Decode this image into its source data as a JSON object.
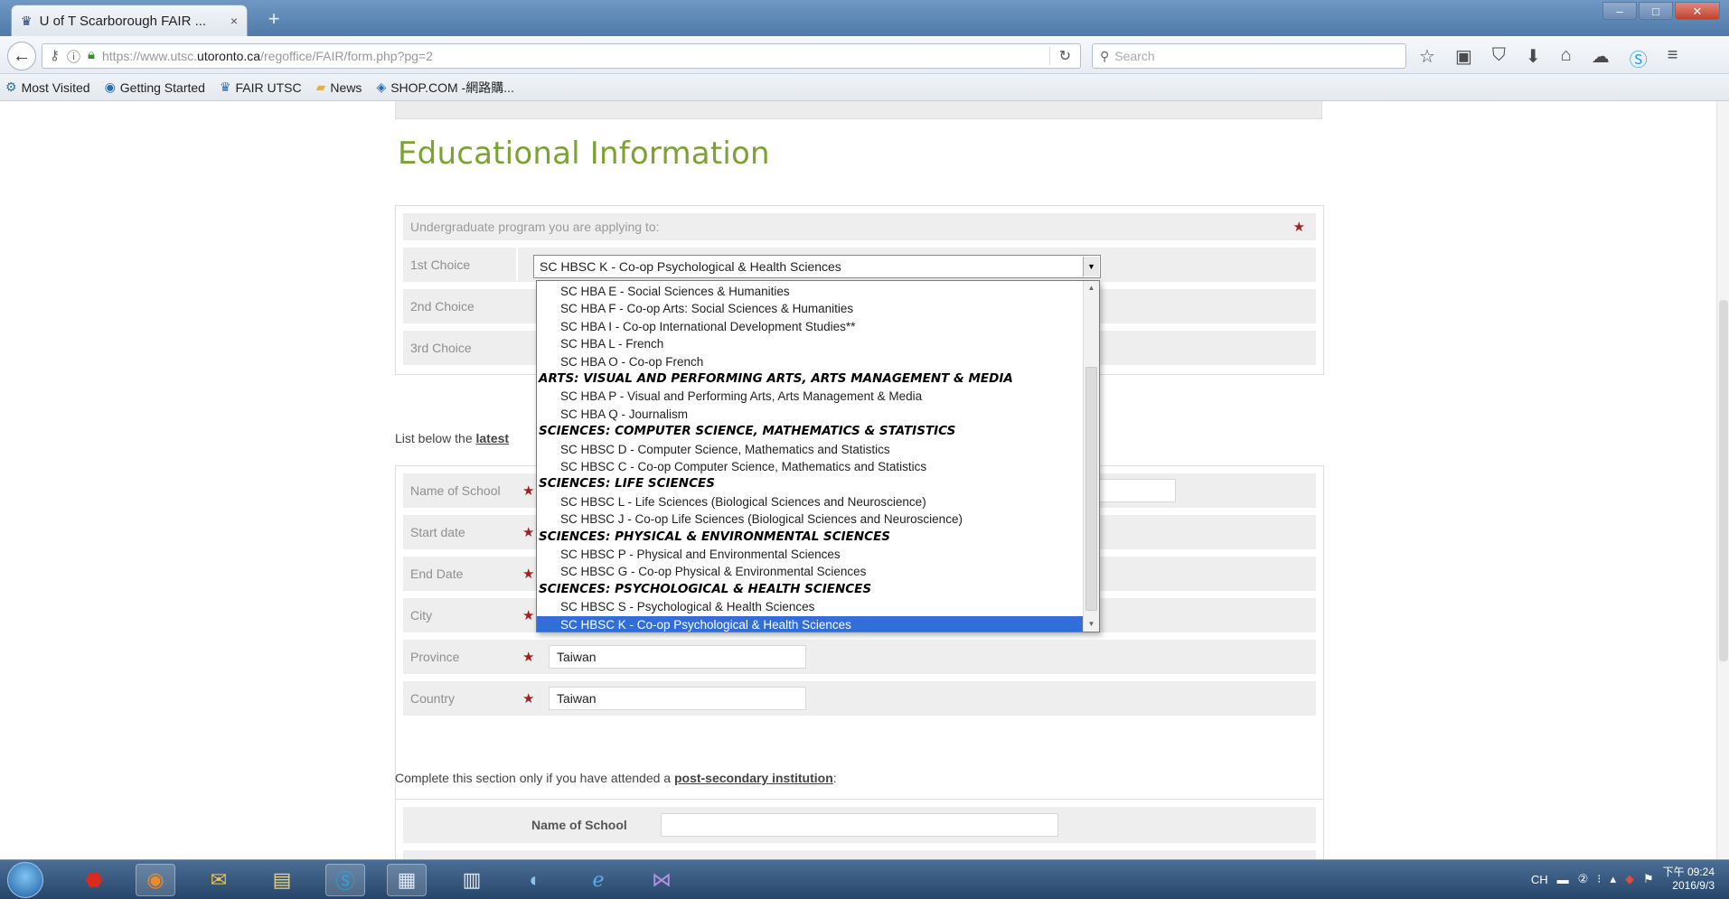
{
  "browser": {
    "tab_title": "U of T Scarborough FAIR ...",
    "tab_close": "×",
    "new_tab": "+",
    "url_prefix": "https://www.utsc.",
    "url_domain": "utoronto.ca",
    "url_path": "/regoffice/FAIR/form.php?pg=2",
    "search_placeholder": "Search",
    "bookmarks": [
      "Most Visited",
      "Getting Started",
      "FAIR UTSC",
      "News",
      "SHOP.COM -網路購..."
    ]
  },
  "page": {
    "section_title": "Educational Information",
    "program": {
      "header": "Undergraduate program you are applying to:",
      "first_label": "1st Choice",
      "second_label": "2nd Choice",
      "third_label": "3rd Choice",
      "first_value": "SC HBSC K - Co-op Psychological & Health Sciences"
    },
    "school_intro_prefix": "List below the",
    "school_intro_link": "latest",
    "school": {
      "name_label": "Name of School",
      "start_label": "Start date",
      "end_label": "End Date",
      "city_label": "City",
      "province_label": "Province",
      "province_value": "Taiwan",
      "country_label": "Country",
      "country_value": "Taiwan"
    },
    "post_intro_prefix": "Complete this section only if you have attended a",
    "post_intro_link": "post-secondary institution",
    "post_intro_suffix": ":",
    "post": {
      "name_label": "Name of School"
    },
    "required_mark": "★"
  },
  "dropdown": {
    "items": [
      {
        "text": "SC HBA E - Social Sciences & Humanities",
        "kind": "option"
      },
      {
        "text": "SC HBA F - Co-op Arts: Social Sciences & Humanities",
        "kind": "option"
      },
      {
        "text": "SC HBA I - Co-op International Development Studies**",
        "kind": "option"
      },
      {
        "text": "SC HBA L - French",
        "kind": "option"
      },
      {
        "text": "SC HBA O - Co-op French",
        "kind": "option"
      },
      {
        "text": "ARTS: VISUAL AND PERFORMING ARTS, ARTS MANAGEMENT & MEDIA",
        "kind": "group"
      },
      {
        "text": "SC HBA P - Visual and Performing Arts, Arts Management & Media",
        "kind": "option"
      },
      {
        "text": "SC HBA Q - Journalism",
        "kind": "option"
      },
      {
        "text": "SCIENCES: COMPUTER SCIENCE, MATHEMATICS & STATISTICS",
        "kind": "group"
      },
      {
        "text": "SC HBSC D - Computer Science, Mathematics and Statistics",
        "kind": "option"
      },
      {
        "text": "SC HBSC C - Co-op Computer Science, Mathematics and Statistics",
        "kind": "option"
      },
      {
        "text": "SCIENCES: LIFE SCIENCES",
        "kind": "group"
      },
      {
        "text": "SC HBSC L - Life Sciences (Biological Sciences and Neuroscience)",
        "kind": "option"
      },
      {
        "text": "SC HBSC J - Co-op Life Sciences (Biological Sciences and Neuroscience)",
        "kind": "option"
      },
      {
        "text": "SCIENCES: PHYSICAL & ENVIRONMENTAL SCIENCES",
        "kind": "group"
      },
      {
        "text": "SC HBSC P - Physical and Environmental Sciences",
        "kind": "option"
      },
      {
        "text": "SC HBSC G - Co-op Physical & Environmental Sciences",
        "kind": "option"
      },
      {
        "text": "SCIENCES: PSYCHOLOGICAL & HEALTH SCIENCES",
        "kind": "group"
      },
      {
        "text": "SC HBSC S - Psychological & Health Sciences",
        "kind": "option"
      },
      {
        "text": "SC HBSC K - Co-op Psychological & Health Sciences",
        "kind": "selected"
      }
    ]
  },
  "taskbar": {
    "tray_lang": "CH",
    "clock_time": "下午 09:24",
    "clock_date": "2016/9/3"
  },
  "colors": {
    "title_green": "#7aa333",
    "required_red": "#a32020",
    "selected_blue": "#2f6fd6"
  }
}
